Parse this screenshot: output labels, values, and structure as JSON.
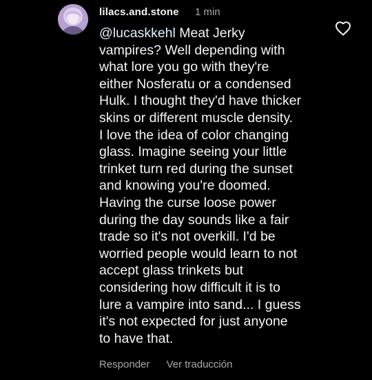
{
  "comment": {
    "username": "lilacs.and.stone",
    "timestamp": "1 min",
    "mention": "@lucaskkehl",
    "text_lines": [
      " Meat Jerky",
      "vampires? Well depending with",
      "what lore you go with they're",
      "either Nosferatu or a condensed",
      "Hulk. I thought they'd have thicker",
      "skins or different muscle density.",
      "I love the idea of color changing",
      "glass. Imagine seeing your little",
      "trinket turn red during the sunset",
      "and knowing you're doomed.",
      "Having the curse loose power",
      "during the day sounds like a fair",
      "trade so it's not overkill. I'd be",
      "worried people would learn to not",
      "accept glass trinkets but",
      "considering how difficult it is to",
      "lure a vampire into sand... I guess",
      "it's not expected for just anyone",
      "to have that."
    ],
    "reply_label": "Responder",
    "translate_label": "Ver traducción",
    "like_icon": "heart-outline-icon"
  },
  "colors": {
    "background": "#000000",
    "text": "#f5f5f5",
    "secondary_text": "#a8a8a8",
    "mention": "#e0f1ff"
  }
}
